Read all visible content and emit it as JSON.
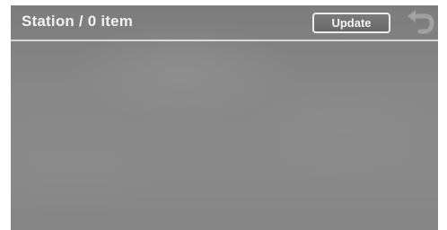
{
  "header": {
    "title": "Station / 0 item",
    "update_label": "Update",
    "back_icon": "back-arrow-icon"
  },
  "list": {
    "items": []
  },
  "colors": {
    "screen_background": "#868686",
    "text": "#f2f2f2",
    "button_border": "#ececec",
    "divider": "#d8d8d8"
  }
}
